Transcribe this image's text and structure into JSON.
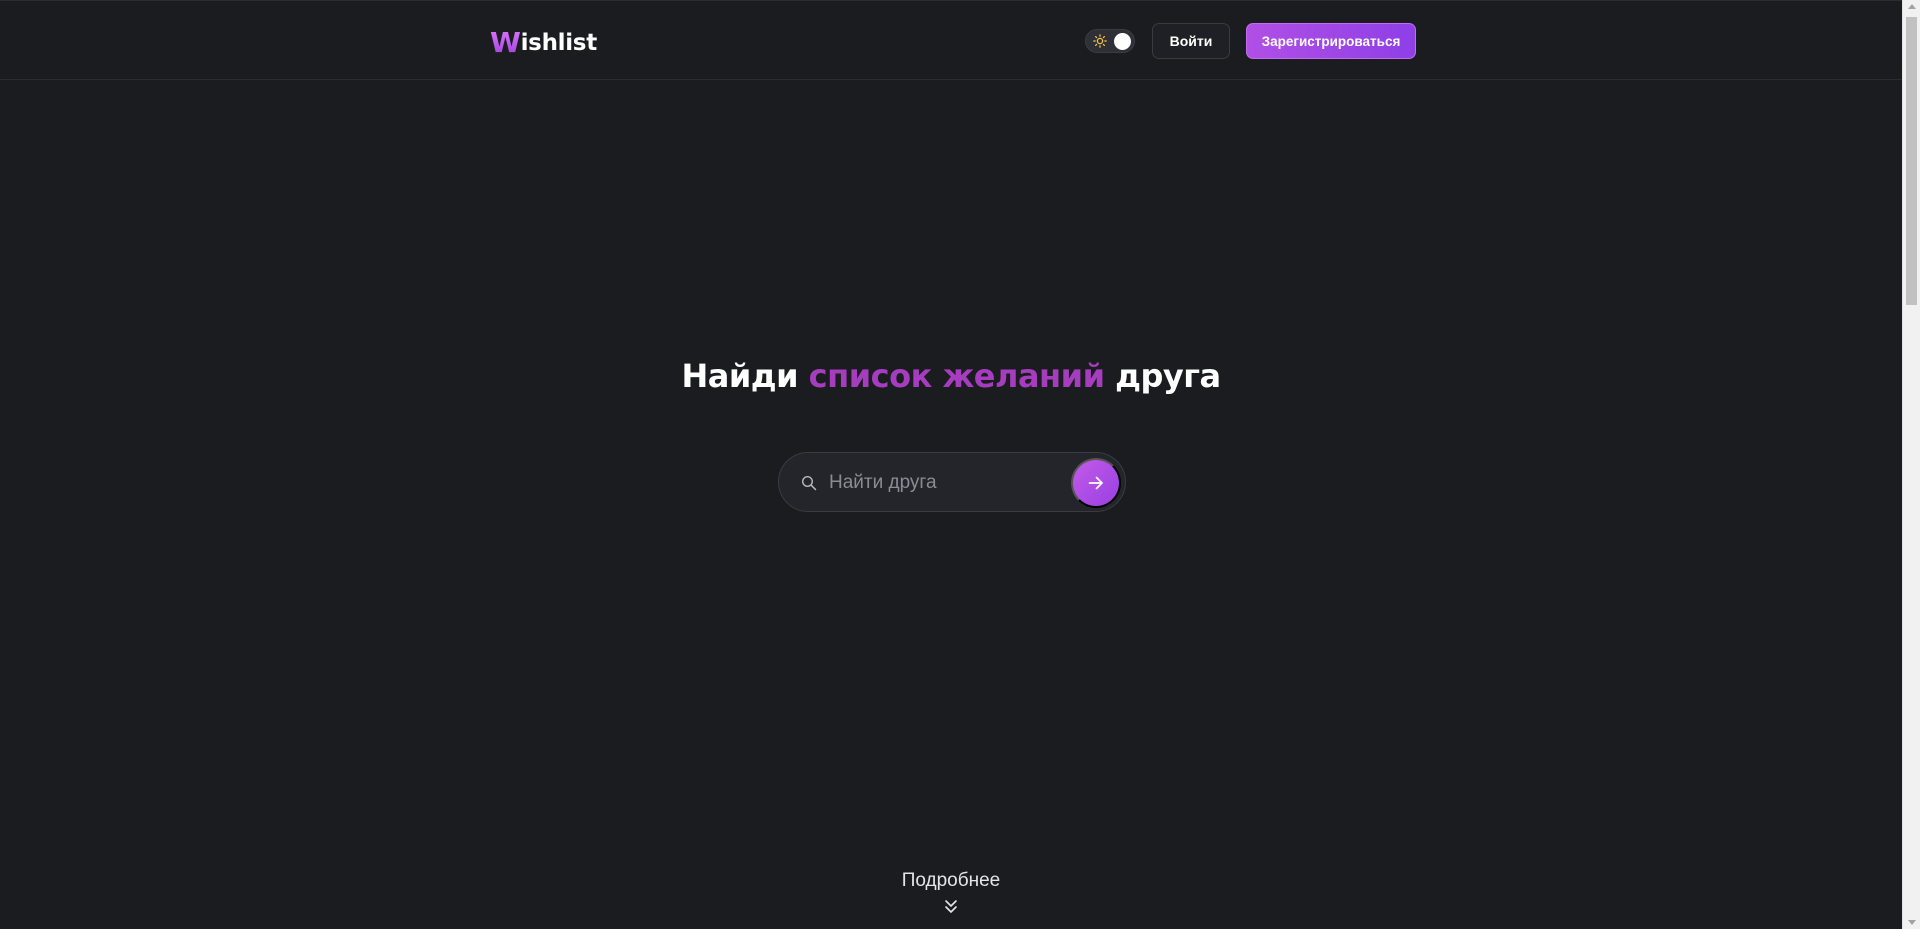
{
  "header": {
    "logo_initial": "W",
    "logo_rest": "ishlist",
    "login_label": "Войти",
    "register_label": "Зарегистрироваться",
    "theme_toggle_icon": "sun-icon"
  },
  "hero": {
    "title_before": "Найди ",
    "title_accent": "список желаний",
    "title_after": " друга"
  },
  "search": {
    "placeholder": "Найти друга",
    "value": "",
    "search_icon": "search-icon",
    "submit_icon": "arrow-right-icon"
  },
  "more": {
    "label": "Подробнее",
    "icon": "double-chevron-down-icon"
  },
  "colors": {
    "background": "#1b1c20",
    "accent": "#a63dbf",
    "button_gradient_start": "#b14fe6",
    "button_gradient_end": "#8e3fe6"
  }
}
